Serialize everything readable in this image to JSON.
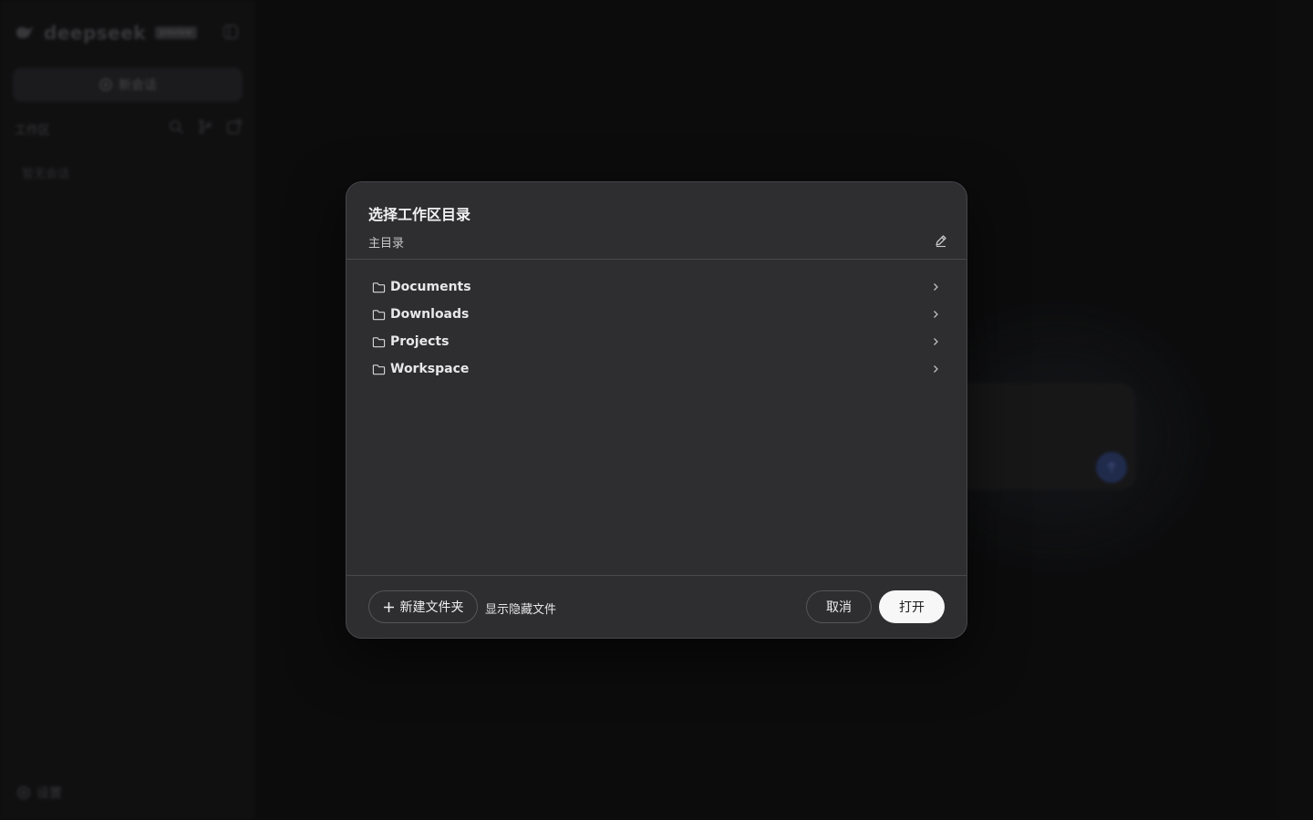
{
  "app": {
    "brand": "deepseek",
    "badge": "preview",
    "new_chat_label": "新会话",
    "workspace_label": "工作区",
    "empty_label": "暂无会话",
    "settings_label": "设置"
  },
  "dialog": {
    "title": "选择工作区目录",
    "current_path": "主目录",
    "folders": [
      {
        "name": "Documents"
      },
      {
        "name": "Downloads"
      },
      {
        "name": "Projects"
      },
      {
        "name": "Workspace"
      }
    ],
    "new_folder_label": "新建文件夹",
    "show_hidden_label": "显示隐藏文件",
    "cancel_label": "取消",
    "open_label": "打开"
  },
  "icons": [
    "deepseek-logo-icon",
    "sidebar-toggle-icon",
    "new-chat-icon",
    "search-icon",
    "branch-icon",
    "new-window-icon",
    "settings-gear-icon",
    "edit-pencil-icon",
    "folder-icon",
    "chevron-right-icon",
    "plus-icon",
    "send-arrow-icon"
  ],
  "colors": {
    "background": "#111112",
    "sidebar": "#161617",
    "dialog_bg": "#2e2e31",
    "dialog_border": "#46464a",
    "primary_button": "#f7f7f8",
    "send_button": "#2b3a66"
  }
}
